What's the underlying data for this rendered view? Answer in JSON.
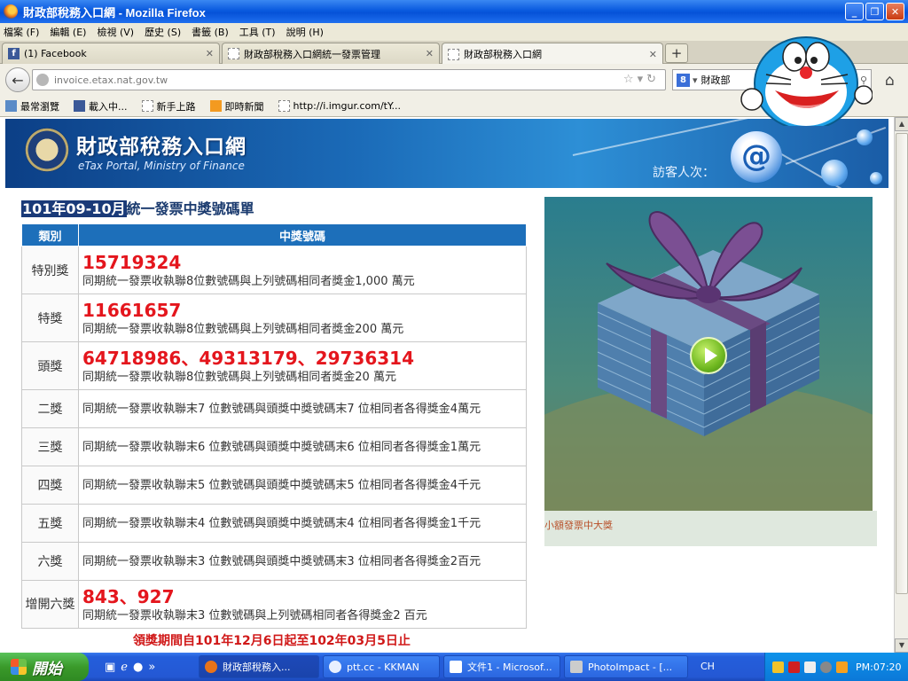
{
  "window": {
    "title": "財政部稅務入口網 - Mozilla Firefox"
  },
  "menu": [
    "檔案 (F)",
    "編輯 (E)",
    "檢視 (V)",
    "歷史 (S)",
    "書籤 (B)",
    "工具 (T)",
    "說明 (H)"
  ],
  "tabs": [
    {
      "label": "(1) Facebook"
    },
    {
      "label": "財政部稅務入口網統一發票管理"
    },
    {
      "label": "財政部稅務入口網"
    }
  ],
  "nav": {
    "url": "invoice.etax.nat.gov.tw",
    "search_value": "財政部"
  },
  "bookmarks": [
    "最常瀏覽",
    "載入中...",
    "新手上路",
    "即時新聞",
    "http://i.imgur.com/tY..."
  ],
  "banner": {
    "title": "財政部稅務入口網",
    "subtitle": "eTax Portal, Ministry of Finance",
    "visitor_label": "訪客人次："
  },
  "page": {
    "heading_highlight": "101年09-10月",
    "heading_rest": "統一發票中獎號碼單",
    "col_category": "類別",
    "col_numbers": "中獎號碼",
    "rows": [
      {
        "category": "特別獎",
        "number": "15719324",
        "desc": "同期統一發票收執聯8位數號碼與上列號碼相同者獎金1,000 萬元"
      },
      {
        "category": "特獎",
        "number": "11661657",
        "desc": "同期統一發票收執聯8位數號碼與上列號碼相同者獎金200 萬元"
      },
      {
        "category": "頭獎",
        "number": "64718986、49313179、29736314",
        "desc": "同期統一發票收執聯8位數號碼與上列號碼相同者獎金20 萬元"
      },
      {
        "category": "二獎",
        "number": "",
        "desc": "同期統一發票收執聯末7 位數號碼與頭獎中獎號碼末7 位相同者各得獎金4萬元"
      },
      {
        "category": "三獎",
        "number": "",
        "desc": "同期統一發票收執聯末6 位數號碼與頭獎中獎號碼末6 位相同者各得獎金1萬元"
      },
      {
        "category": "四獎",
        "number": "",
        "desc": "同期統一發票收執聯末5 位數號碼與頭獎中獎號碼末5 位相同者各得獎金4千元"
      },
      {
        "category": "五獎",
        "number": "",
        "desc": "同期統一發票收執聯末4 位數號碼與頭獎中獎號碼末4 位相同者各得獎金1千元"
      },
      {
        "category": "六獎",
        "number": "",
        "desc": "同期統一發票收執聯末3 位數號碼與頭獎中獎號碼末3 位相同者各得獎金2百元"
      },
      {
        "category": "增開六獎",
        "number": "843、927",
        "desc": "同期統一發票收執聯末3 位數號碼與上列號碼相同者各得獎金2 百元"
      }
    ],
    "claim_period": "領獎期間自101年12月6日起至102年03月5日止",
    "promo_caption": "小額發票中大獎"
  },
  "taskbar": {
    "start_label": "開始",
    "tasks": [
      "財政部稅務入...",
      "ptt.cc - KKMAN",
      "文件1 - Microsof...",
      "PhotoImpact - [..."
    ],
    "lang": "CH",
    "clock": "PM:07:20"
  }
}
